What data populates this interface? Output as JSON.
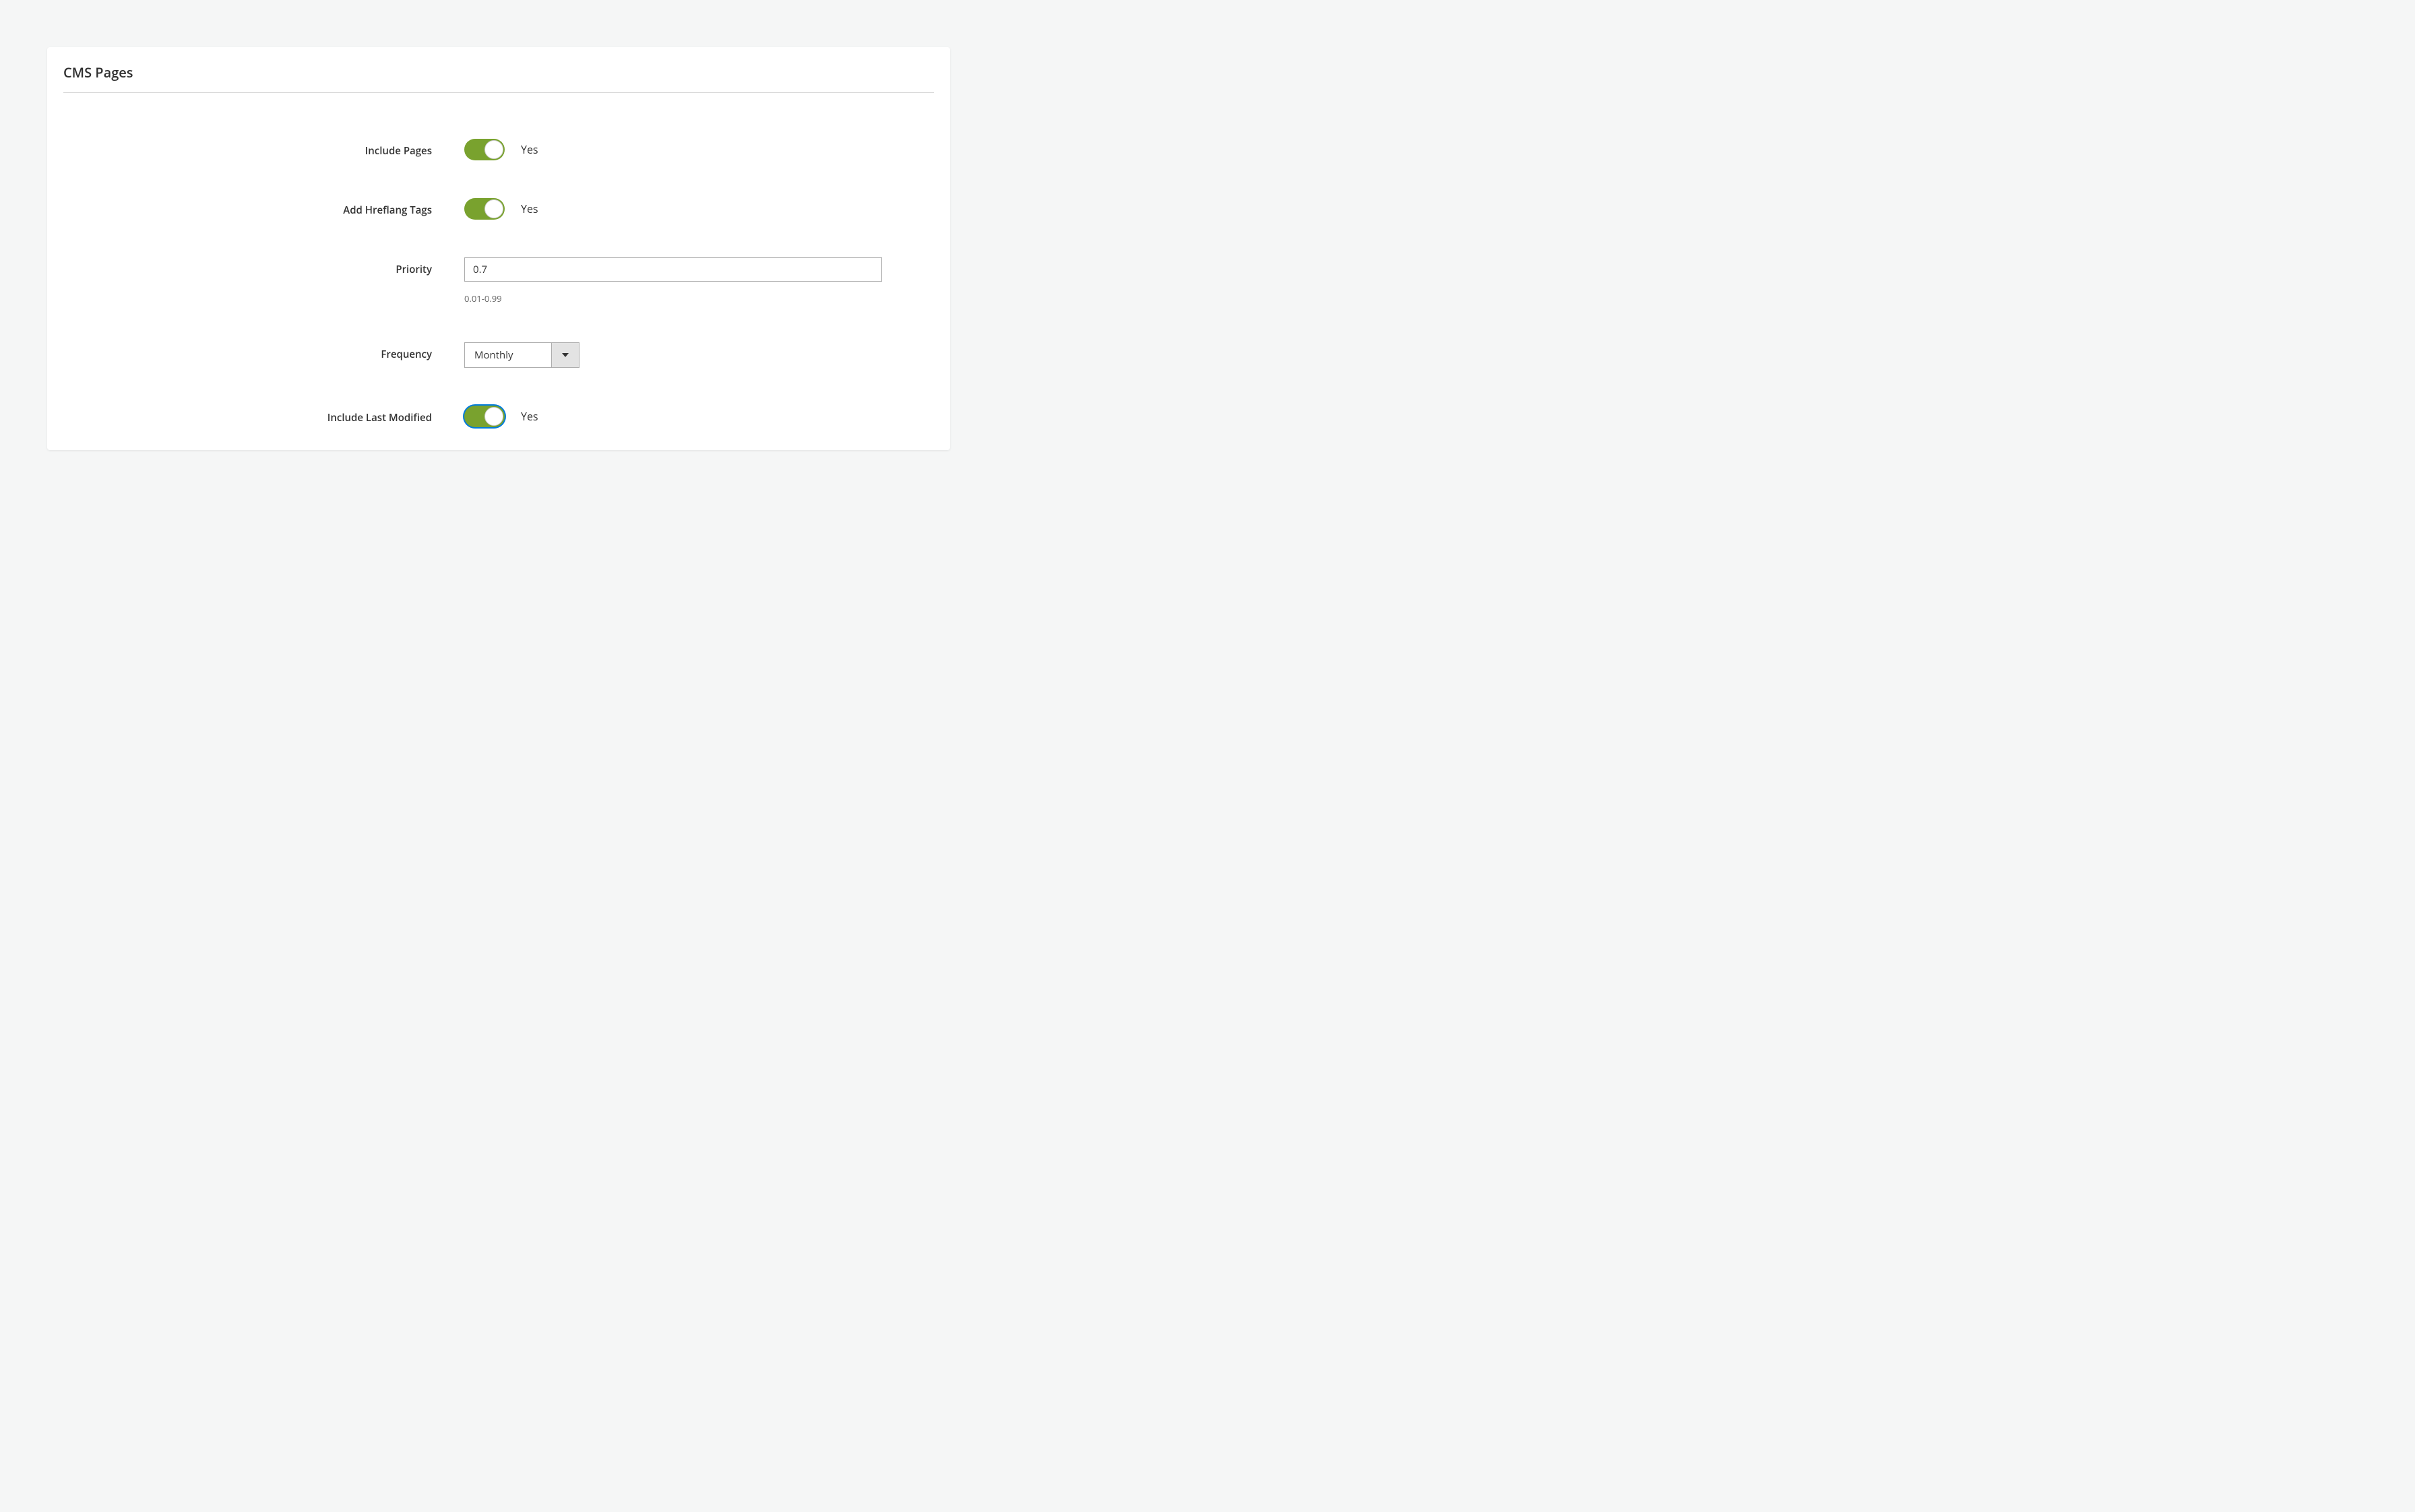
{
  "panel": {
    "title": "CMS Pages"
  },
  "fields": {
    "includePages": {
      "label": "Include Pages",
      "value": "Yes"
    },
    "addHreflangTags": {
      "label": "Add Hreflang Tags",
      "value": "Yes"
    },
    "priority": {
      "label": "Priority",
      "value": "0.7",
      "helper": "0.01-0.99"
    },
    "frequency": {
      "label": "Frequency",
      "value": "Monthly"
    },
    "includeLastModified": {
      "label": "Include Last Modified",
      "value": "Yes"
    }
  }
}
